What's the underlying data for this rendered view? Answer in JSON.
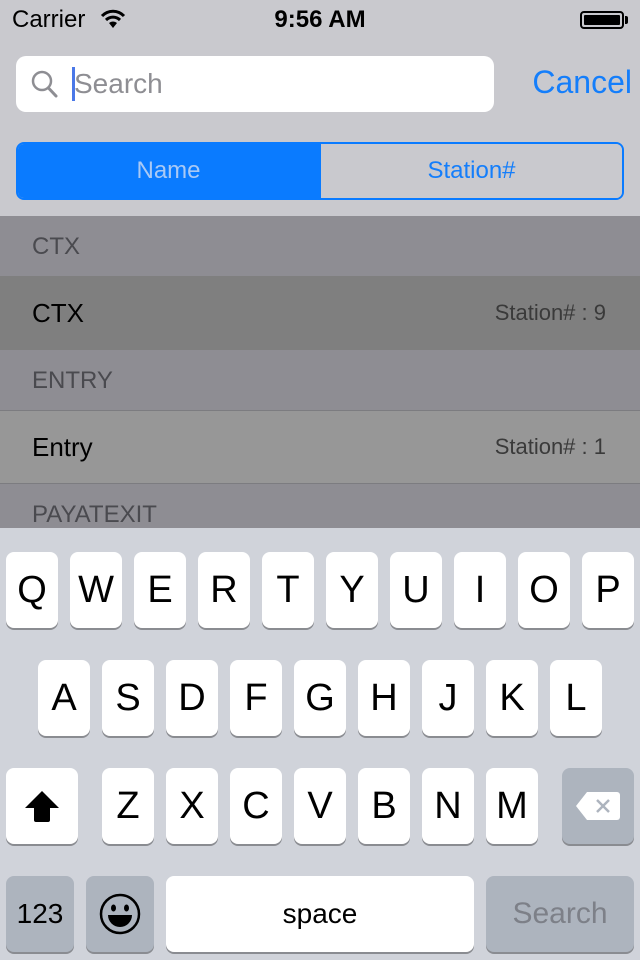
{
  "status_bar": {
    "carrier": "Carrier",
    "time": "9:56 AM",
    "wifi_icon": "wifi-icon",
    "battery_icon": "battery-icon"
  },
  "search": {
    "placeholder": "Search",
    "value": "",
    "icon": "search-icon",
    "cancel_label": "Cancel"
  },
  "scope": {
    "options": [
      "Name",
      "Station#"
    ],
    "selected": "Name"
  },
  "list": {
    "sections": [
      {
        "header": "CTX",
        "rows": [
          {
            "title": "CTX",
            "detail": "Station# : 9",
            "selected": true
          }
        ]
      },
      {
        "header": "ENTRY",
        "rows": [
          {
            "title": "Entry",
            "detail": "Station# : 1",
            "selected": false
          }
        ]
      },
      {
        "header": "PAYATEXIT",
        "rows": []
      }
    ]
  },
  "keyboard": {
    "row1": [
      "Q",
      "W",
      "E",
      "R",
      "T",
      "Y",
      "U",
      "I",
      "O",
      "P"
    ],
    "row2": [
      "A",
      "S",
      "D",
      "F",
      "G",
      "H",
      "J",
      "K",
      "L"
    ],
    "row3": [
      "Z",
      "X",
      "C",
      "V",
      "B",
      "N",
      "M"
    ],
    "shift_icon": "shift-icon",
    "delete_icon": "delete-icon",
    "numbers_label": "123",
    "emoji_icon": "emoji-icon",
    "space_label": "space",
    "return_label": "Search"
  },
  "colors": {
    "accent": "#0a7bff",
    "link": "#147efb"
  }
}
